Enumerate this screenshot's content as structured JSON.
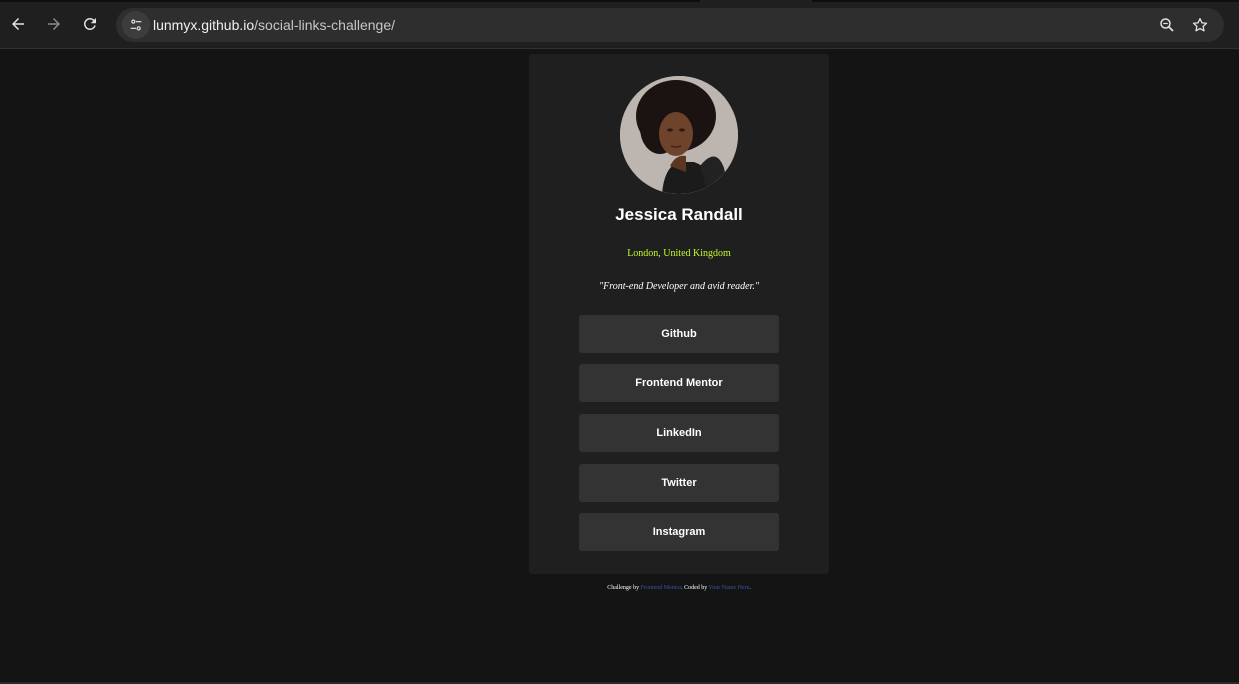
{
  "browser": {
    "url_host": "lunmyx.github.io",
    "url_path": "/social-links-challenge/"
  },
  "profile": {
    "name": "Jessica Randall",
    "location": "London, United Kingdom",
    "bio": "\"Front-end Developer and avid reader.\""
  },
  "links": [
    {
      "label": "Github"
    },
    {
      "label": "Frontend Mentor"
    },
    {
      "label": "LinkedIn"
    },
    {
      "label": "Twitter"
    },
    {
      "label": "Instagram"
    }
  ],
  "attribution": {
    "prefix": "Challenge by ",
    "fm_link": "Frontend Mentor",
    "middle": ". Coded by ",
    "author_link": "Your Name Here",
    "suffix": "."
  },
  "colors": {
    "page_bg": "#141414",
    "card_bg": "#1f1f1f",
    "button_bg": "#333333",
    "accent_green": "#c4f82a",
    "link_blue": "#3e52a3"
  },
  "icons": {
    "back": "arrow-left-icon",
    "forward": "arrow-right-icon",
    "reload": "reload-icon",
    "site_info": "tune-icon",
    "zoom": "zoom-icon",
    "bookmark": "star-icon"
  }
}
